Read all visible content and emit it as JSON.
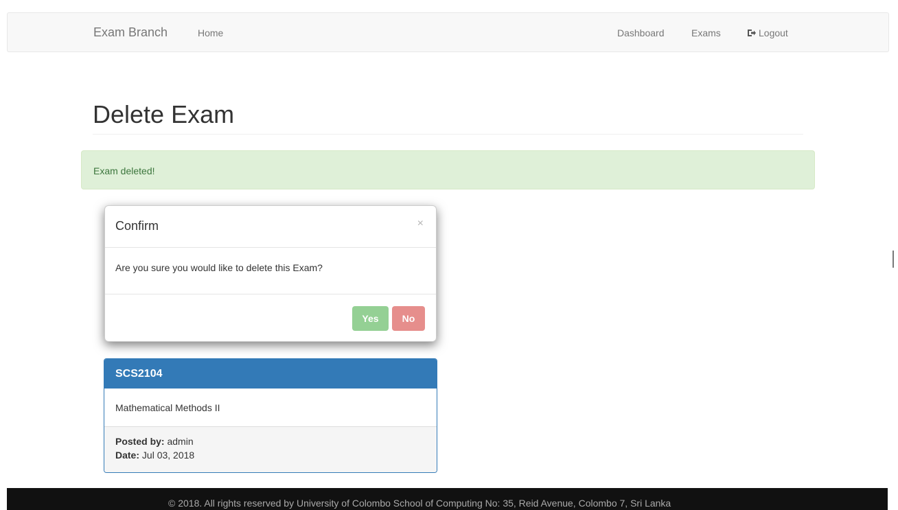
{
  "navbar": {
    "brand": "Exam Branch",
    "home": "Home",
    "dashboard": "Dashboard",
    "exams": "Exams",
    "logout": "Logout",
    "logout_icon": "logout-icon"
  },
  "page": {
    "title": "Delete Exam"
  },
  "alert": {
    "text": "Exam deleted!",
    "color": "#3c763d",
    "background": "#dff0d8"
  },
  "modal": {
    "title": "Confirm",
    "close": "×",
    "message": "Are you sure you would like to delete this Exam?",
    "yes_label": "Yes",
    "no_label": "No"
  },
  "exam_panel": {
    "code": "SCS2104",
    "name": "Mathematical Methods II",
    "posted_by_label": "Posted by:",
    "posted_by": "admin",
    "date_label": "Date:",
    "date": "Jul 03, 2018",
    "accent": "#337ab7"
  },
  "footer": {
    "text": "© 2018. All rights reserved by University of Colombo School of Computing No: 35, Reid Avenue, Colombo 7, Sri Lanka"
  }
}
